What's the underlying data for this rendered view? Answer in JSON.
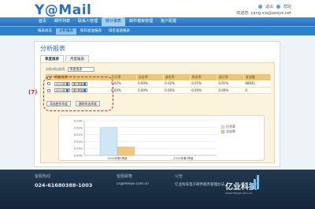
{
  "app": {
    "logo": "Y@Mail",
    "top_links": [
      "退出",
      "帮助"
    ],
    "welcome": "欢迎您: yang.xia@eeeye.net"
  },
  "nav": {
    "items": [
      "首页",
      "邮件列表",
      "联系人管理",
      "统计报表",
      "邮件模板管理",
      "账户配置"
    ],
    "active_index": 3
  },
  "subnav": {
    "items": [
      "报表总览",
      "分析报表",
      "按日发送报表",
      "域名发送报表"
    ],
    "active_index": 1
  },
  "panel": {
    "title": "分析报表",
    "tabs": [
      "季度报表",
      "月度报表"
    ],
    "active_tab": 0,
    "option_label": "分析对比选项:",
    "option_value": "季度报表"
  },
  "table": {
    "headers": [
      "季度选择",
      "",
      "打开率",
      "点击率",
      "退信率",
      "投诉率",
      "退订率",
      "发送量"
    ],
    "rows": [
      {
        "year": "2010年",
        "quarter": "第1季度",
        "open": "0.02%",
        "click": "0.00%",
        "bounce": "0.02%",
        "complaint": "0.01%",
        "unsub": "0.01%",
        "sent": "88641"
      },
      {
        "year": "2010年",
        "quarter": "第1季度",
        "open": "0.00%",
        "click": "0.00%",
        "bounce": "0.00%",
        "complaint": "0.00%",
        "unsub": "0.00%",
        "sent": "0"
      }
    ]
  },
  "buttons": {
    "add": "添加更多季度",
    "delete": "删除所选季度"
  },
  "annotation": "(7)",
  "chart_data": {
    "type": "bar",
    "categories": [
      "2010年第1季度",
      "2010年第1季度"
    ],
    "series": [
      {
        "name": "打开率",
        "values": [
          0.02,
          0.0
        ],
        "color": "#cfe6f7"
      },
      {
        "name": "点击率",
        "values": [
          0.006,
          0.0
        ],
        "color": "#f3c77a"
      }
    ],
    "y_ticks": [
      "0.00%",
      "0.01%",
      "0.01%",
      "0.01%",
      "0.02%",
      "0.03%"
    ],
    "ylim": [
      0,
      0.025
    ]
  },
  "footer": {
    "col1_title": "客服热线",
    "col1_value": "024-61680388-1003",
    "col2_title": "客服邮箱",
    "col2_value": "cs@eeeye.com.cn",
    "col3_title": "公告",
    "col3_value": "亿业科技电子邮件服务管理办法",
    "brand": "亿业科技",
    "brand_url": "www.eeeye.com.cn"
  }
}
